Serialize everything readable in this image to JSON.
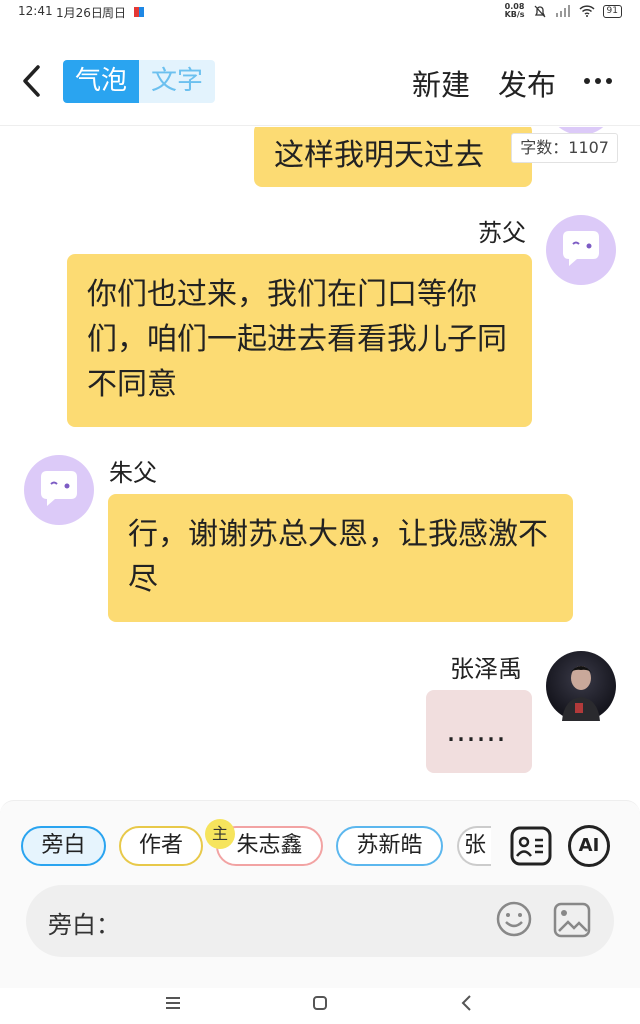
{
  "status_bar": {
    "time": "12:41",
    "date": "1月26日",
    "weekday": "周日",
    "speed_value": "0.08",
    "speed_unit": "KB/s",
    "battery": "91"
  },
  "header": {
    "tab_bubble": "气泡",
    "tab_text": "文字",
    "new_label": "新建",
    "publish_label": "发布"
  },
  "chat": {
    "word_count": "字数：1107",
    "messages": [
      {
        "speaker": "",
        "text": "这样我明天过去",
        "side": "right"
      },
      {
        "speaker": "苏父",
        "text": "你们也过来，我们在门口等你们，咱们一起进去看看我儿子同不同意",
        "side": "right"
      },
      {
        "speaker": "朱父",
        "text": "行，谢谢苏总大恩，让我感激不尽",
        "side": "left"
      },
      {
        "speaker": "张泽禹",
        "text": "……",
        "side": "right"
      }
    ]
  },
  "roles": {
    "items": [
      {
        "label": "旁白",
        "border": "#2aa4f0",
        "bg": "#e6f4fd"
      },
      {
        "label": "作者",
        "border": "#e8c94a",
        "bg": "#ffffff"
      },
      {
        "label": "朱志鑫",
        "border": "#f2a3a3",
        "bg": "#ffffff"
      },
      {
        "label": "苏新皓",
        "border": "#5cb7ee",
        "bg": "#ffffff"
      },
      {
        "label": "张",
        "border": "#cccccc",
        "bg": "#ffffff"
      }
    ],
    "main_badge": "主",
    "ai_label": "AI"
  },
  "composer": {
    "prefix": "旁白："
  },
  "colors": {
    "accent": "#2aa4f0",
    "bubble": "#fcdb73",
    "avatar_bg": "#dccaf8"
  },
  "icons": [
    "back-icon",
    "more-icon",
    "role-card-icon",
    "ai-icon",
    "emoji-icon",
    "image-icon"
  ]
}
